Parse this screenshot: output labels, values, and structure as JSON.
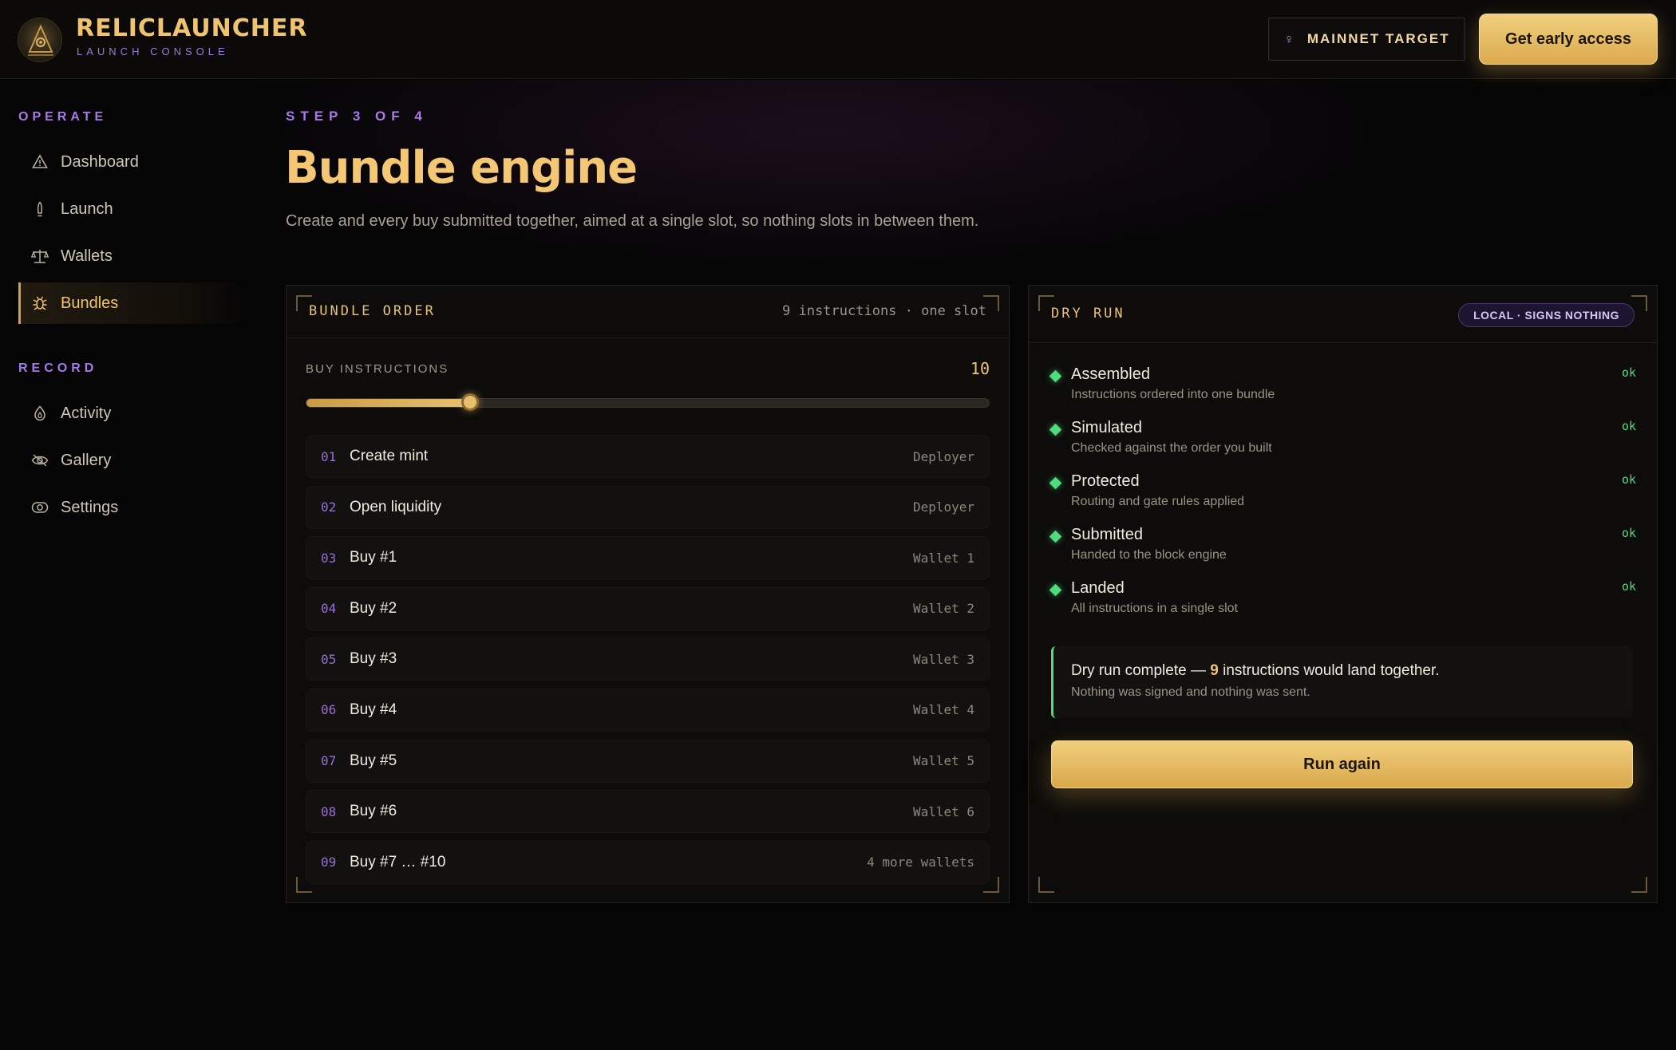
{
  "header": {
    "brand_name": "RELICLAUNCHER",
    "brand_sub": "LAUNCH CONSOLE",
    "target_label": "MAINNET TARGET",
    "cta_label": "Get early access"
  },
  "sidebar": {
    "operate_label": "OPERATE",
    "record_label": "RECORD",
    "items": [
      {
        "label": "Dashboard",
        "icon": "warning-triangle-icon"
      },
      {
        "label": "Launch",
        "icon": "rocket-icon"
      },
      {
        "label": "Wallets",
        "icon": "scales-icon"
      },
      {
        "label": "Bundles",
        "icon": "bug-icon",
        "active": true
      },
      {
        "label": "Activity",
        "icon": "flame-icon"
      },
      {
        "label": "Gallery",
        "icon": "eye-icon"
      },
      {
        "label": "Settings",
        "icon": "toggle-icon"
      }
    ]
  },
  "page": {
    "step": "STEP 3 OF 4",
    "title": "Bundle engine",
    "description": "Create and every buy submitted together, aimed at a single slot, so nothing slots in between them."
  },
  "bundle_order": {
    "title": "BUNDLE ORDER",
    "meta": "9 instructions · one slot",
    "buy_label": "BUY INSTRUCTIONS",
    "buy_count": "10",
    "slider_fraction": 0.24,
    "rows": [
      {
        "num": "01",
        "name": "Create mint",
        "who": "Deployer"
      },
      {
        "num": "02",
        "name": "Open liquidity",
        "who": "Deployer"
      },
      {
        "num": "03",
        "name": "Buy #1",
        "who": "Wallet 1"
      },
      {
        "num": "04",
        "name": "Buy #2",
        "who": "Wallet 2"
      },
      {
        "num": "05",
        "name": "Buy #3",
        "who": "Wallet 3"
      },
      {
        "num": "06",
        "name": "Buy #4",
        "who": "Wallet 4"
      },
      {
        "num": "07",
        "name": "Buy #5",
        "who": "Wallet 5"
      },
      {
        "num": "08",
        "name": "Buy #6",
        "who": "Wallet 6"
      },
      {
        "num": "09",
        "name": "Buy #7 … #10",
        "who": "4 more wallets"
      }
    ]
  },
  "dry_run": {
    "title": "DRY RUN",
    "badge": "LOCAL · SIGNS NOTHING",
    "checks": [
      {
        "title": "Assembled",
        "sub": "Instructions ordered into one bundle",
        "status": "ok"
      },
      {
        "title": "Simulated",
        "sub": "Checked against the order you built",
        "status": "ok"
      },
      {
        "title": "Protected",
        "sub": "Routing and gate rules applied",
        "status": "ok"
      },
      {
        "title": "Submitted",
        "sub": "Handed to the block engine",
        "status": "ok"
      },
      {
        "title": "Landed",
        "sub": "All instructions in a single slot",
        "status": "ok"
      }
    ],
    "result_prefix": "Dry run complete — ",
    "result_count": "9",
    "result_suffix": " instructions would land together.",
    "result_sub": "Nothing was signed and nothing was sent.",
    "run_again": "Run again"
  },
  "colors": {
    "accent_gold": "#f0c46e",
    "accent_purple": "#a77ae8",
    "status_ok": "#4fdb7e"
  }
}
